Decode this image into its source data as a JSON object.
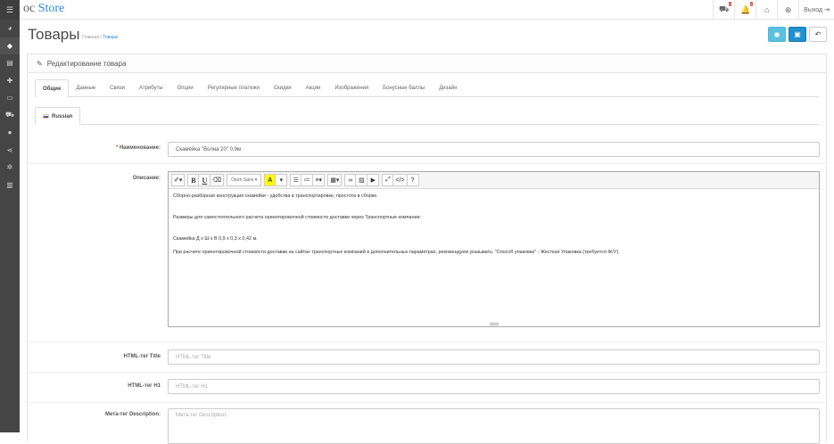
{
  "header": {
    "logo_a": "oc",
    "logo_b": "Store",
    "badge1": "",
    "badge2": "",
    "exit_label": "Выход"
  },
  "sidebar": {
    "items": [
      "dashboard-icon",
      "tags-icon",
      "list-icon",
      "puzzle-icon",
      "desktop-icon",
      "cart-icon",
      "user-icon",
      "share-icon",
      "gear-icon",
      "chart-icon"
    ]
  },
  "page": {
    "title": "Товары",
    "breadcrumb": [
      "Главная",
      "Товары"
    ]
  },
  "panel": {
    "heading": "Редактирование товара"
  },
  "tabs": [
    "Общие",
    "Данные",
    "Связи",
    "Атрибуты",
    "Опции",
    "Регулярные платежи",
    "Скидки",
    "Акции",
    "Изображения",
    "Бонусные баллы",
    "Дизайн"
  ],
  "language_tab": "Russian",
  "form": {
    "name_label": "Наименование:",
    "name_value": "Скамейка \"Волна 20\" 0,9м",
    "description_label": "Описание:",
    "font_select": "Open Sans",
    "description_paragraphs": [
      "Сборно-разборная конструкция скамейки - удобства в транспортировке, простота в сборке.",
      "Размеры для самостоятельного расчета ориентировочной стоимости доставки через Транспортные компании:",
      "Скамейка Д х Ш х В 0,9 х 0,3 х 0,42 м.",
      "При расчете ориентировочной стоимости доставки на сайтах транспортных компаний в дополнительных параметрах, рекомендуем указывать: \"Способ упаковки\" - Жесткая Упаковка (требуется Ж/У)."
    ],
    "html_title_label": "HTML-тег Title",
    "html_title_placeholder": "HTML-тег Title",
    "html_h1_label": "HTML-тег H1",
    "html_h1_placeholder": "HTML-тег H1",
    "meta_desc_label": "Мета-тег Description:",
    "meta_desc_placeholder": "Мета-тег Description:"
  }
}
